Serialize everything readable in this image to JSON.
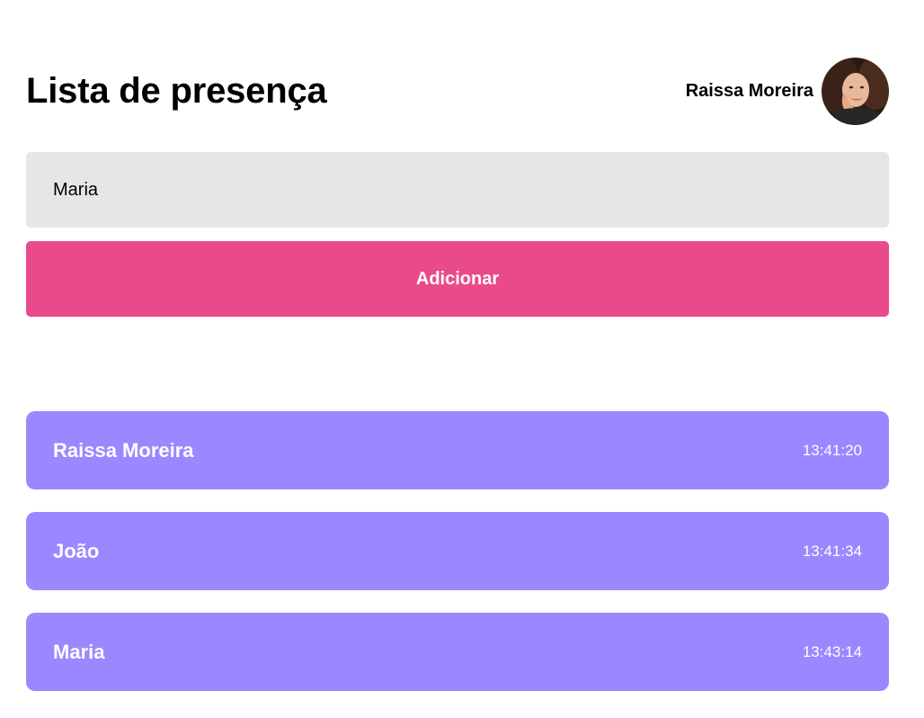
{
  "header": {
    "title": "Lista de presença",
    "user_name": "Raissa Moreira"
  },
  "form": {
    "input_value": "Maria",
    "button_label": "Adicionar"
  },
  "students": [
    {
      "name": "Raissa Moreira",
      "time": "13:41:20"
    },
    {
      "name": "João",
      "time": "13:41:34"
    },
    {
      "name": "Maria",
      "time": "13:43:14"
    }
  ],
  "colors": {
    "accent": "#e94b8a",
    "card": "#9b87ff",
    "input_bg": "#e6e6e6"
  }
}
